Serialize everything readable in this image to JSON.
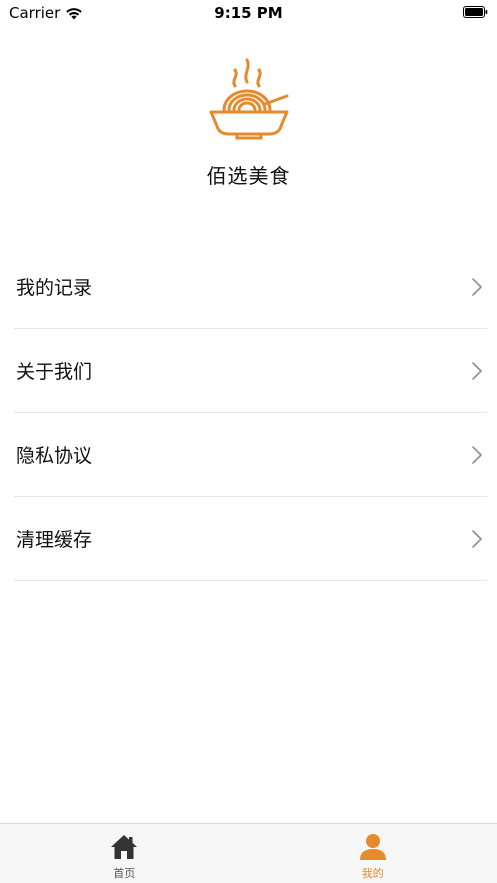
{
  "status_bar": {
    "carrier": "Carrier",
    "time": "9:15 PM",
    "icons": [
      "wifi-icon",
      "battery-icon"
    ]
  },
  "brand": {
    "name": "佰选美食",
    "logo_icon": "noodle-bowl-icon",
    "accent_color": "#e68a2e"
  },
  "menu": {
    "items": [
      {
        "label": "我的记录",
        "icon": "chevron-right-icon"
      },
      {
        "label": "关于我们",
        "icon": "chevron-right-icon"
      },
      {
        "label": "隐私协议",
        "icon": "chevron-right-icon"
      },
      {
        "label": "清理缓存",
        "icon": "chevron-right-icon"
      }
    ]
  },
  "tab_bar": {
    "tabs": [
      {
        "label": "首页",
        "icon": "home-icon",
        "selected": false,
        "color": "#333333"
      },
      {
        "label": "我的",
        "icon": "person-icon",
        "selected": true,
        "color": "#e68a2e"
      }
    ]
  }
}
